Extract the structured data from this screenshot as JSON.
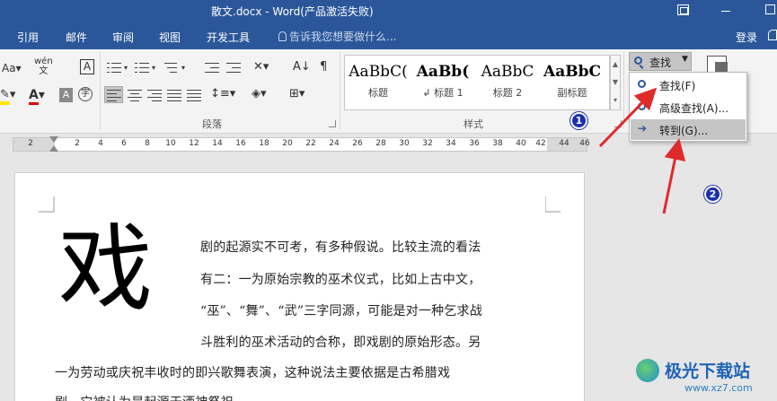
{
  "window": {
    "title": "散文.docx - Word(产品激活失败)",
    "login": "登录"
  },
  "tabs": [
    "引用",
    "邮件",
    "审阅",
    "视图",
    "开发工具"
  ],
  "tell_me": "告诉我您想要做什么...",
  "ribbon": {
    "paragraph_group": "段落",
    "styles_group": "样式",
    "font_controls": [
      "Aa",
      "wén",
      "A"
    ],
    "styles": [
      {
        "sample": "AaBbC(",
        "name": "标题",
        "bold": false
      },
      {
        "sample": "AaBb(",
        "name": "↲ 标题 1",
        "bold": true
      },
      {
        "sample": "AaBbC",
        "name": "标题 2",
        "bold": false
      },
      {
        "sample": "AaBbC",
        "name": "副标题",
        "bold": true
      }
    ]
  },
  "find": {
    "button_label": "查找",
    "menu": [
      {
        "label": "查找(F)",
        "icon": "search-icon"
      },
      {
        "label": "高级查找(A)...",
        "icon": "advanced-find-icon"
      },
      {
        "label": "转到(G)...",
        "icon": "arrow-right-icon"
      }
    ]
  },
  "ruler": {
    "left_labels": [
      "2"
    ],
    "labels": [
      "2",
      "4",
      "6",
      "8",
      "10",
      "12",
      "14",
      "16",
      "18",
      "20",
      "22",
      "24",
      "26",
      "28",
      "30",
      "32",
      "34",
      "36",
      "38",
      "40",
      "42"
    ],
    "right_labels": [
      "44",
      "46"
    ]
  },
  "document": {
    "drop_cap": "戏",
    "lines": [
      "剧的起源实不可考，有多种假说。比较主流的看法",
      "有二：一为原始宗教的巫术仪式，比如上古中文，",
      "“巫”、“舞”、“武”三字同源，可能是对一种乞求战",
      "斗胜利的巫术活动的合称，即戏剧的原始形态。另",
      "一为劳动或庆祝丰收时的即兴歌舞表演，这种说法主要依据是古希腊戏",
      "剧，它被认为是起源于酒神祭祀"
    ]
  },
  "annotations": {
    "badges": [
      "1",
      "2"
    ],
    "arrow_color": "#e02a2a"
  },
  "watermark": {
    "main": "极光下载站",
    "sub": "www.xz7.com"
  },
  "colors": {
    "brand": "#2b579a",
    "highlight": "#c5c5c5"
  }
}
